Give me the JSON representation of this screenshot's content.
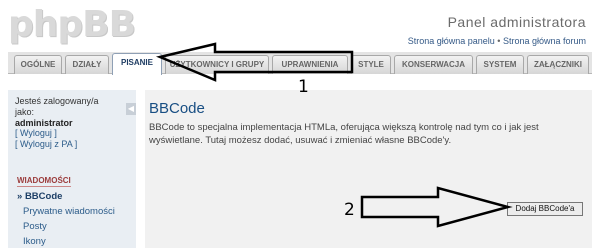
{
  "header": {
    "logo": "phpBB",
    "title": "Panel administratora",
    "links": [
      "Strona główna panelu",
      "•",
      "Strona główna forum"
    ]
  },
  "tabs": [
    {
      "label": "OGÓLNE"
    },
    {
      "label": "DZIAŁY"
    },
    {
      "label": "PISANIE"
    },
    {
      "label": "UŻYTKOWNICY I GRUPY"
    },
    {
      "label": "UPRAWNIENIA"
    },
    {
      "label": "STYLE"
    },
    {
      "label": "KONSERWACJA"
    },
    {
      "label": "SYSTEM"
    },
    {
      "label": "ZAŁĄCZNIKI"
    }
  ],
  "sidebar": {
    "logged_label": "Jesteś zalogowany/a jako:",
    "username": "administrator",
    "logout": "[ Wyloguj ]",
    "logout_pa": "[ Wyloguj z PA ]",
    "section": "WIADOMOŚCI",
    "items": [
      {
        "label": "BBCode"
      },
      {
        "label": "Prywatne wiadomości"
      },
      {
        "label": "Posty"
      },
      {
        "label": "Ikony"
      }
    ]
  },
  "main": {
    "title": "BBCode",
    "description": "BBCode to specjalna implementacja HTMLa, oferująca większą kontrolę nad tym co i jak jest wyświetlane. Tutaj możesz dodać, usuwać i zmieniać własne BBCode'y.",
    "add_button": "Dodaj BBCode'a"
  },
  "annotations": {
    "label1": "1",
    "label2": "2"
  }
}
